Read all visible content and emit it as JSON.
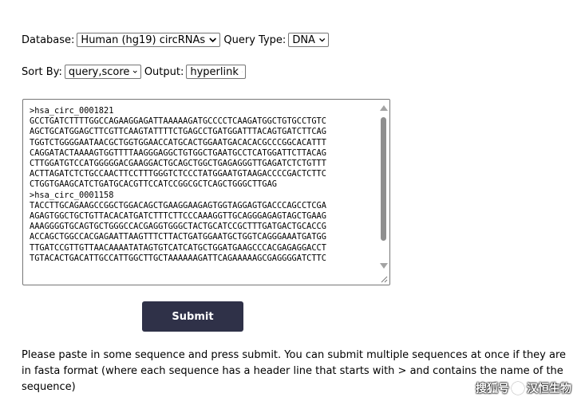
{
  "form": {
    "database_label": "Database:",
    "database_value": "Human (hg19) circRNAs",
    "query_type_label": "Query Type:",
    "query_type_value": "DNA",
    "sort_by_label": "Sort By:",
    "sort_by_value": "query,score",
    "output_label": "Output:",
    "output_value": "hyperlink",
    "sequence_text": ">hsa_circ_0001821\nGCCTGATCTTTTGGCCAGAAGGAGATTAAAAAGATGCCCCTCAAGATGGCTGTGCCTGTC\nAGCTGCATGGAGCTTCGTTCAAGTATTTTCTGAGCCTGATGGATTTACAGTGATCTTCAG\nTGGTCTGGGGAATAACGCTGGTGGAACCATGCACTGGAATGACACACGCCCGGCACATTT\nCAGGATACTAAAAGTGGTTTTAAGGGAGGCTGTGGCTGAATGCCTCATGGATTCTTACAG\nCTTGGATGTCCATGGGGGACGAAGGACTGCAGCTGGCTGAGAGGGTTGAGATCTCTGTTT\nACTTAGATCTCTGCCAACTTCCTTTGGGTCTCCCTATGGAATGTAAGACCCCGACTCTTC\nCTGGTGAAGCATCTGATGCACGTTCCATCCGGCGCTCAGCTGGGCTTGAG\n>hsa_circ_0001158\nTACCTTGCAGAAGCCGGCTGGACAGCTGAAGGAAGAGTGGTAGGAGTGACCCAGCCTCGA\nAGAGTGGCTGCTGTTACACATGATCTTTCTTCCCAAAGGTTGCAGGGAGAGTAGCTGAAG\nAAAGGGGTGCAGTGCTGGGCCACGAGGTGGGCTACTGCATCCGCTTTGATGACTGCACCG\nACCAGCTGGCCACGAGAATTAAGTTTCTTACTGATGGAATGCTGGTCAGGGAAATGATGG\nTTGATCCGTTGTTAACAAAATATAGTGTCATCATGCTGGATGAAGCCCACGAGAGGACCT\nTGTACACTGACATTGCCATTGGCTTGCTAAAAAAGATTCAGAAAAAGCGAGGGGATCTTC",
    "submit_label": "Submit"
  },
  "help_text": "Please paste in some sequence and press submit. You can submit multiple sequences at once if they are in fasta format (where each sequence has a header line that starts with > and contains the name of the sequence)",
  "watermark": {
    "left_text": "搜狐号",
    "right_text": "汉恒生物"
  },
  "icons": {
    "select_arrow": "chevron-down-icon",
    "scroll_up": "scroll-up-arrow-icon",
    "scroll_down": "scroll-down-arrow-icon",
    "resize": "resize-grip-icon",
    "watermark_badge": "at-badge-icon"
  },
  "colors": {
    "submit_bg": "#2f3148",
    "submit_text": "#ffffff",
    "border": "#767676"
  }
}
